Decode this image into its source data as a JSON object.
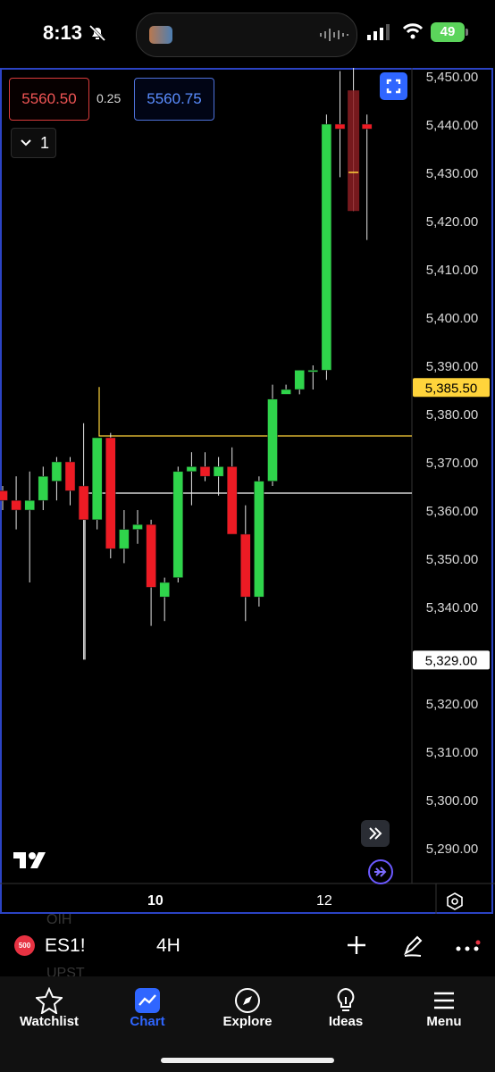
{
  "status": {
    "time": "8:13",
    "battery": "49"
  },
  "trading": {
    "sell_price": "5560.50",
    "spread": "0.25",
    "buy_price": "5560.75",
    "quantity": "1"
  },
  "chart_data": {
    "type": "candlestick",
    "symbol": "ES1!",
    "interval": "4H",
    "y_ticks": [
      "5,450.00",
      "5,440.00",
      "5,430.00",
      "5,420.00",
      "5,410.00",
      "5,400.00",
      "5,390.00",
      "5,380.00",
      "5,370.00",
      "5,360.00",
      "5,350.00",
      "5,340.00",
      "5,320.00",
      "5,310.00",
      "5,300.00",
      "5,290.00"
    ],
    "x_ticks": [
      "10",
      "12"
    ],
    "horizontal_levels": [
      {
        "price": "5,385.50",
        "value": 5385.5,
        "color": "#ffd43b"
      },
      {
        "price": "5,329.00",
        "value": 5329.0,
        "color": "#ffffff"
      }
    ],
    "candles": [
      {
        "o": 5364,
        "h": 5365,
        "l": 5360,
        "c": 5362,
        "color": "red"
      },
      {
        "o": 5362,
        "h": 5367,
        "l": 5356,
        "c": 5360,
        "color": "red"
      },
      {
        "o": 5360,
        "h": 5368,
        "l": 5345,
        "c": 5362,
        "color": "green"
      },
      {
        "o": 5362,
        "h": 5369,
        "l": 5360,
        "c": 5367,
        "color": "green"
      },
      {
        "o": 5366,
        "h": 5371,
        "l": 5362,
        "c": 5370,
        "color": "green"
      },
      {
        "o": 5370,
        "h": 5371,
        "l": 5361,
        "c": 5364,
        "color": "red"
      },
      {
        "o": 5365,
        "h": 5378,
        "l": 5329,
        "c": 5358,
        "color": "red"
      },
      {
        "o": 5358,
        "h": 5375,
        "l": 5356,
        "c": 5375,
        "color": "green"
      },
      {
        "o": 5375,
        "h": 5376,
        "l": 5350,
        "c": 5352,
        "color": "red"
      },
      {
        "o": 5352,
        "h": 5360,
        "l": 5349,
        "c": 5356,
        "color": "green"
      },
      {
        "o": 5356,
        "h": 5360,
        "l": 5353,
        "c": 5357,
        "color": "green"
      },
      {
        "o": 5357,
        "h": 5358,
        "l": 5336,
        "c": 5344,
        "color": "red"
      },
      {
        "o": 5342,
        "h": 5346,
        "l": 5337,
        "c": 5345,
        "color": "green"
      },
      {
        "o": 5346,
        "h": 5369,
        "l": 5345,
        "c": 5368,
        "color": "green"
      },
      {
        "o": 5368,
        "h": 5372,
        "l": 5361,
        "c": 5369,
        "color": "green"
      },
      {
        "o": 5369,
        "h": 5372,
        "l": 5366,
        "c": 5367,
        "color": "red"
      },
      {
        "o": 5369,
        "h": 5371,
        "l": 5363,
        "c": 5367,
        "color": "green"
      },
      {
        "o": 5369,
        "h": 5373,
        "l": 5355,
        "c": 5355,
        "color": "red"
      },
      {
        "o": 5355,
        "h": 5361,
        "l": 5337,
        "c": 5342,
        "color": "red"
      },
      {
        "o": 5342,
        "h": 5367,
        "l": 5340,
        "c": 5366,
        "color": "green"
      },
      {
        "o": 5366,
        "h": 5386,
        "l": 5365,
        "c": 5383,
        "color": "green"
      },
      {
        "o": 5384,
        "h": 5386,
        "l": 5384,
        "c": 5385,
        "color": "green"
      },
      {
        "o": 5385,
        "h": 5389,
        "l": 5384,
        "c": 5389,
        "color": "green"
      },
      {
        "o": 5389,
        "h": 5390,
        "l": 5385,
        "c": 5389,
        "color": "green"
      },
      {
        "o": 5389,
        "h": 5442,
        "l": 5387,
        "c": 5440,
        "color": "green"
      },
      {
        "o": 5440,
        "h": 5451,
        "l": 5429,
        "c": 5439,
        "color": "red"
      },
      {
        "o": 5447,
        "h": 5452,
        "l": 5422,
        "c": 5422,
        "color": "red",
        "shaded": true
      },
      {
        "o": 5440,
        "h": 5442,
        "l": 5416,
        "c": 5439,
        "color": "red"
      }
    ]
  },
  "toolbar": {
    "symbol_badge": "500",
    "symbol": "ES1!",
    "interval": "4H"
  },
  "background": {
    "row_1": "OIH",
    "row_2": "UPST"
  },
  "nav": {
    "items": [
      {
        "label": "Watchlist",
        "icon": "star-icon"
      },
      {
        "label": "Chart",
        "icon": "chart-icon",
        "active": true
      },
      {
        "label": "Explore",
        "icon": "compass-icon"
      },
      {
        "label": "Ideas",
        "icon": "lightbulb-icon"
      },
      {
        "label": "Menu",
        "icon": "menu-icon"
      }
    ]
  },
  "colors": {
    "accent": "#2f66ff",
    "up": "#2fd44b",
    "down": "#ed1b24",
    "yellow": "#ffd43b"
  }
}
